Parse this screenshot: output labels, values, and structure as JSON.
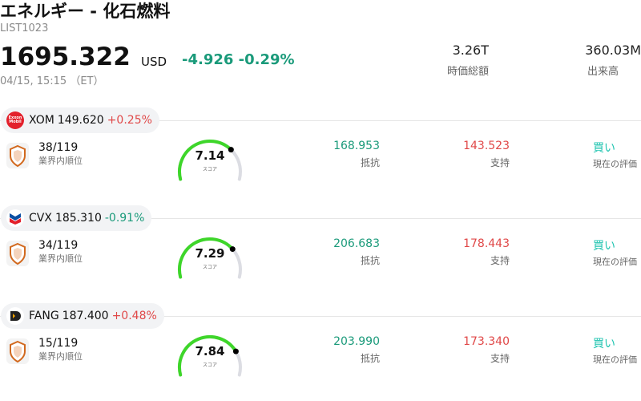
{
  "header": {
    "title": "エネルギー - 化石燃料",
    "code": "LIST1023",
    "price": "1695.322",
    "currency": "USD",
    "change": "-4.926 -0.29%",
    "timestamp": "04/15, 15:15 （ET）",
    "market_cap_value": "3.26T",
    "market_cap_label": "時価総額",
    "volume_value": "360.03M",
    "volume_label": "出来高"
  },
  "stocks": [
    {
      "ticker": "XOM",
      "price": "149.620",
      "change": "+0.25%",
      "direction": "up",
      "logo_text": "Exxon Mobil",
      "logo_color": "#e3202b",
      "rank": "38/119",
      "rank_label": "業界内順位",
      "score": "7.14",
      "score_fraction": 0.71,
      "score_label": "スコア",
      "resistance": "168.953",
      "resistance_label": "抵抗",
      "support": "143.523",
      "support_label": "支持",
      "evaluation": "買い",
      "evaluation_label": "現在の評価"
    },
    {
      "ticker": "CVX",
      "price": "185.310",
      "change": "-0.91%",
      "direction": "down",
      "logo_text": "",
      "logo_color": "#0b4fa3",
      "rank": "34/119",
      "rank_label": "業界内順位",
      "score": "7.29",
      "score_fraction": 0.73,
      "score_label": "スコア",
      "resistance": "206.683",
      "resistance_label": "抵抗",
      "support": "178.443",
      "support_label": "支持",
      "evaluation": "買い",
      "evaluation_label": "現在の評価"
    },
    {
      "ticker": "FANG",
      "price": "187.400",
      "change": "+0.48%",
      "direction": "up",
      "logo_text": "",
      "logo_color": "#222222",
      "rank": "15/119",
      "rank_label": "業界内順位",
      "score": "7.84",
      "score_fraction": 0.78,
      "score_label": "スコア",
      "resistance": "203.990",
      "resistance_label": "抵抗",
      "support": "173.340",
      "support_label": "支持",
      "evaluation": "買い",
      "evaluation_label": "現在の評価"
    }
  ],
  "colors": {
    "up": "#e04848",
    "down": "#1a9a7a",
    "gauge": "#3ed62a",
    "gauge_track": "#dcdde3",
    "buy": "#1fc4b0"
  }
}
